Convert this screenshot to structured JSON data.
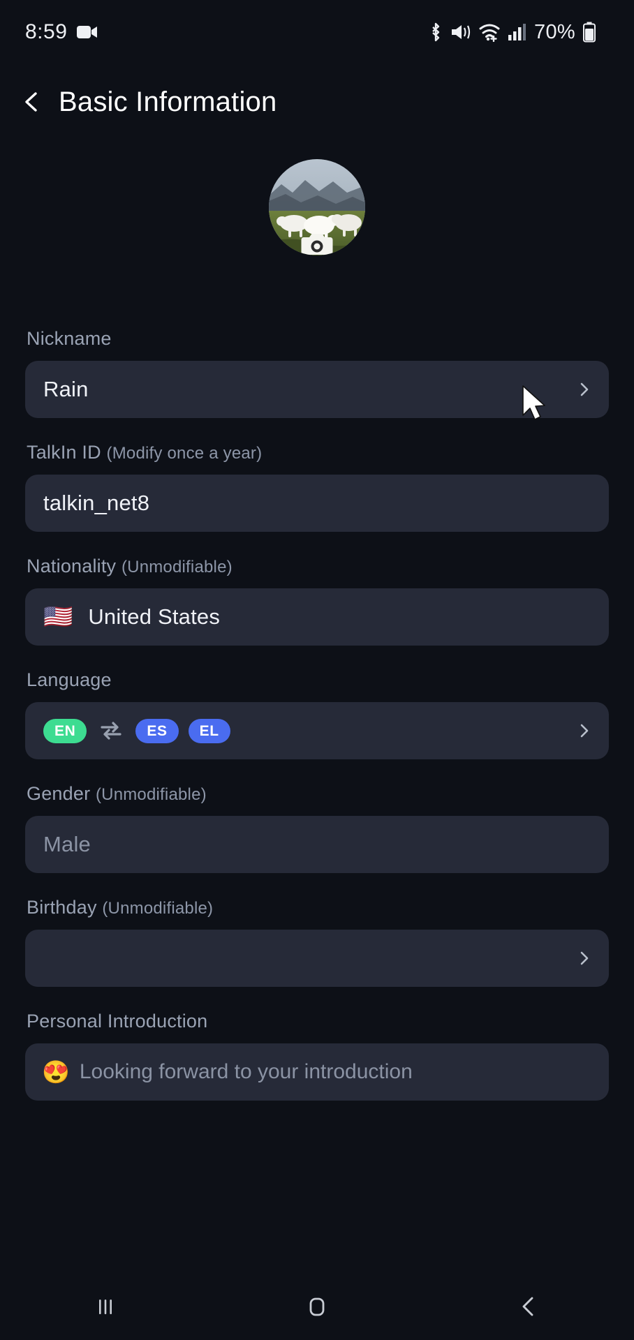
{
  "status_bar": {
    "time": "8:59",
    "battery_percent": "70%",
    "icons": [
      "video-camera-icon",
      "bluetooth-icon",
      "mute-vibrate-icon",
      "wifi-icon",
      "cellular-signal-icon",
      "battery-icon"
    ]
  },
  "header": {
    "title": "Basic Information",
    "back_icon": "back-chevron-icon"
  },
  "avatar": {
    "description": "sheep on grassy hillside",
    "camera_badge_icon": "camera-icon"
  },
  "fields": {
    "nickname": {
      "label": "Nickname",
      "value": "Rain",
      "has_chevron": true
    },
    "talkin_id": {
      "label": "TalkIn ID",
      "hint": "(Modify once a year)",
      "value": "talkin_net8",
      "has_chevron": false
    },
    "nationality": {
      "label": "Nationality",
      "hint": "(Unmodifiable)",
      "flag": "🇺🇸",
      "value": "United States",
      "has_chevron": false
    },
    "language": {
      "label": "Language",
      "source": {
        "code": "EN",
        "color": "#3ddc91"
      },
      "swap_icon": "swap-arrows-icon",
      "targets": [
        {
          "code": "ES",
          "color": "#4a6cf0"
        },
        {
          "code": "EL",
          "color": "#4a6cf0"
        }
      ],
      "has_chevron": true
    },
    "gender": {
      "label": "Gender",
      "hint": "(Unmodifiable)",
      "value": "Male",
      "has_chevron": false
    },
    "birthday": {
      "label": "Birthday",
      "hint": "(Unmodifiable)",
      "value": "",
      "has_chevron": true
    },
    "personal_introduction": {
      "label": "Personal Introduction",
      "emoji": "😍",
      "placeholder": "Looking forward to your introduction",
      "value": ""
    }
  },
  "nav_bar": {
    "recents_label": "recents-icon",
    "home_label": "home-icon",
    "back_label": "back-icon"
  },
  "colors": {
    "page_background": "#0d1017",
    "field_background": "#262a38",
    "label_text": "#9aa3b4",
    "value_text": "#f0f2f7",
    "muted_text": "#8b93a4",
    "accent_green": "#3ddc91",
    "accent_blue": "#4a6cf0"
  },
  "cursor": {
    "present": true
  }
}
